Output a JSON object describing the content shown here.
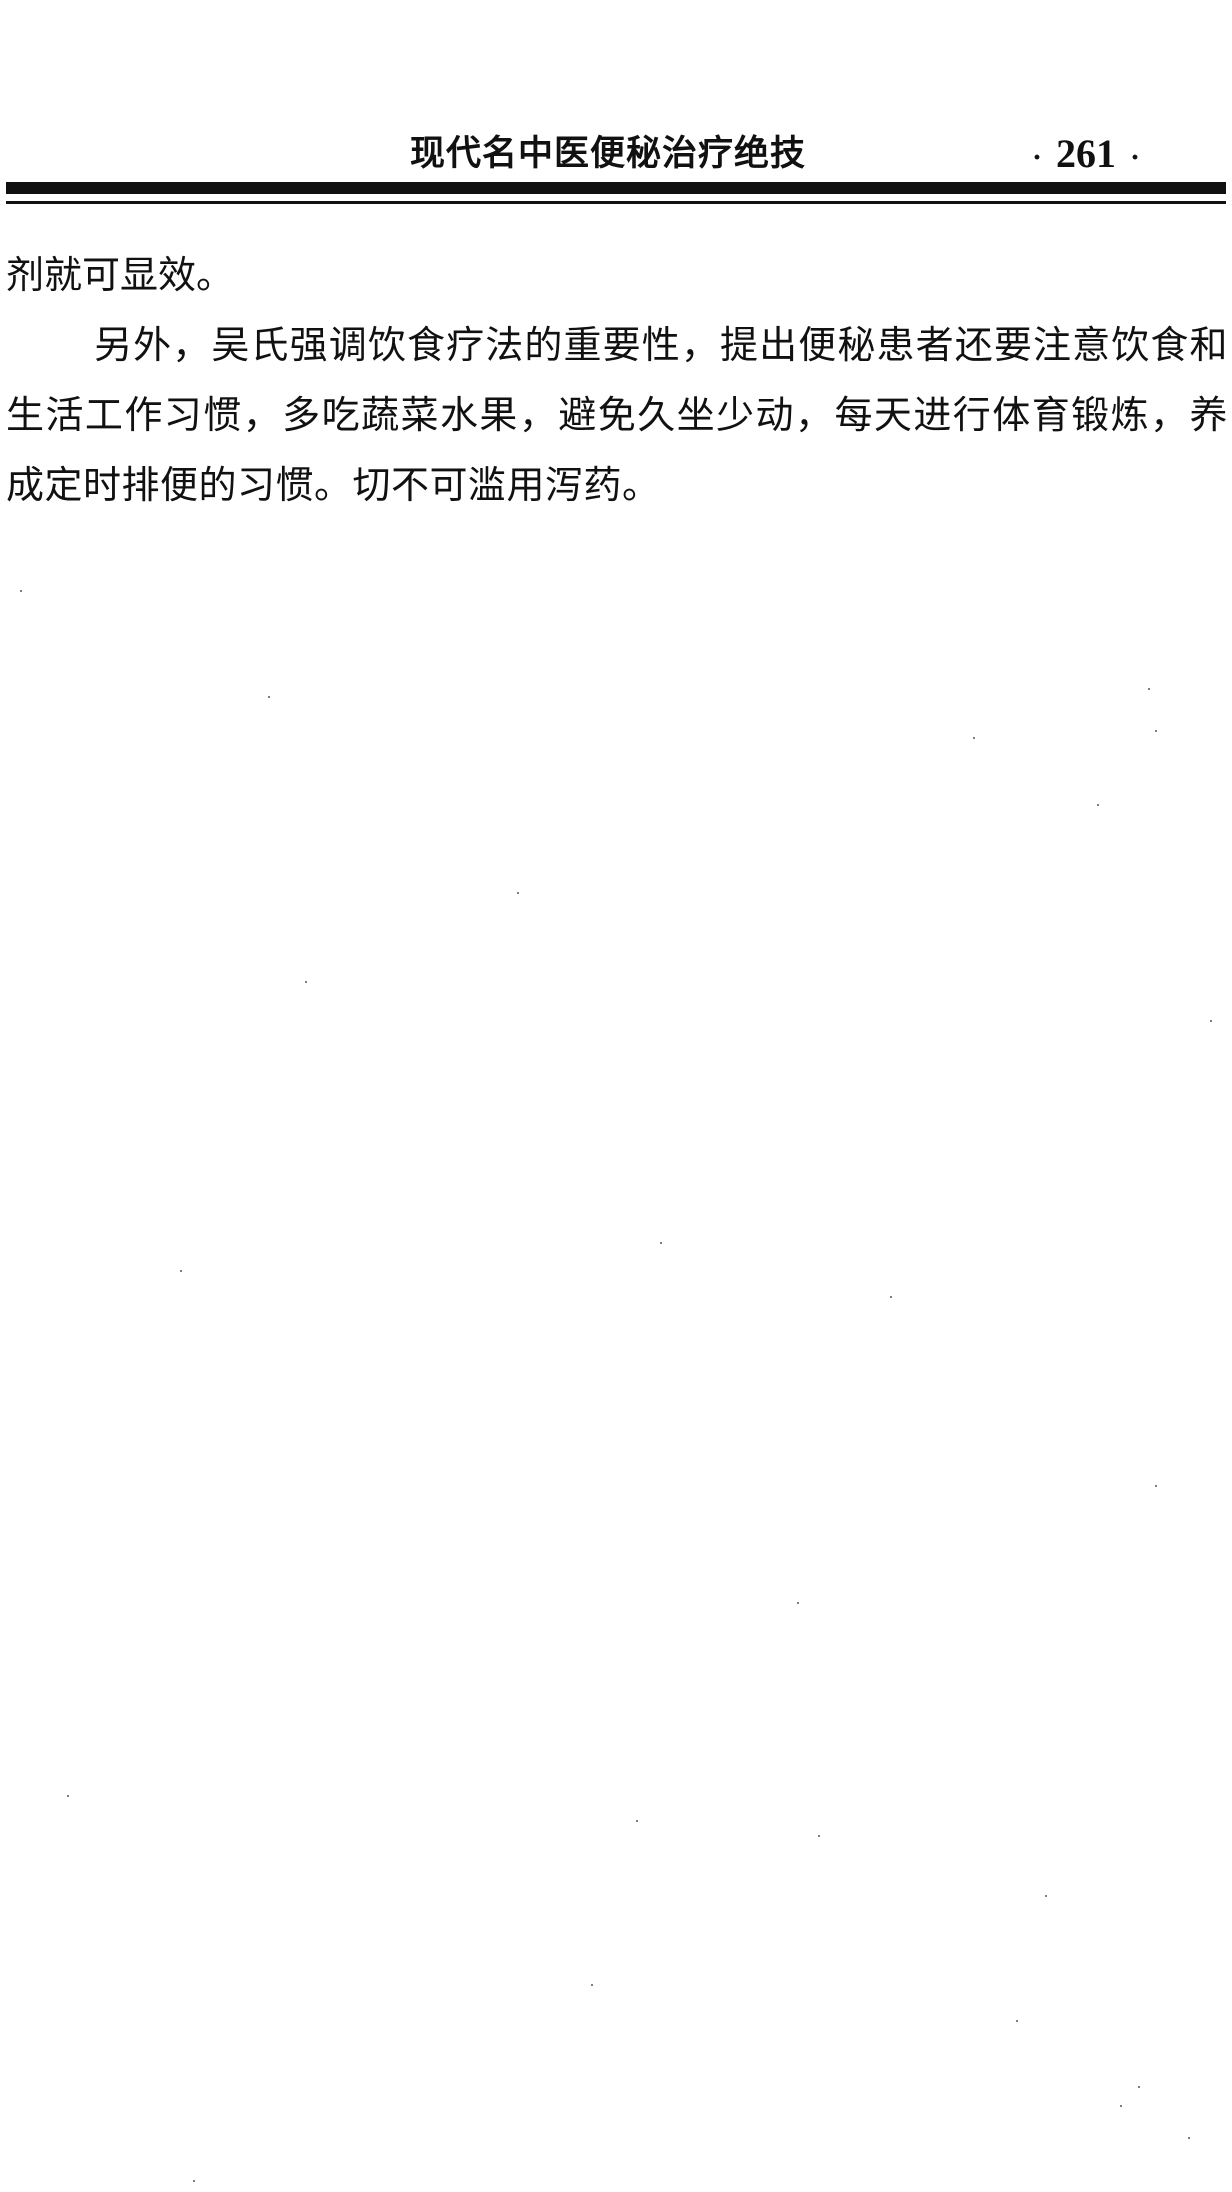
{
  "header": {
    "running_title": "现代名中医便秘治疗绝技",
    "page_number": "261",
    "page_number_dot": "·"
  },
  "body": {
    "paragraphs": [
      "剂就可显效。",
      "另外，吴氏强调饮食疗法的重要性，提出便秘患者还要注意饮食和生活工作习惯，多吃蔬菜水果，避免久坐少动，每天进行体育锻炼，养成定时排便的习惯。切不可滥用泻药。"
    ]
  }
}
